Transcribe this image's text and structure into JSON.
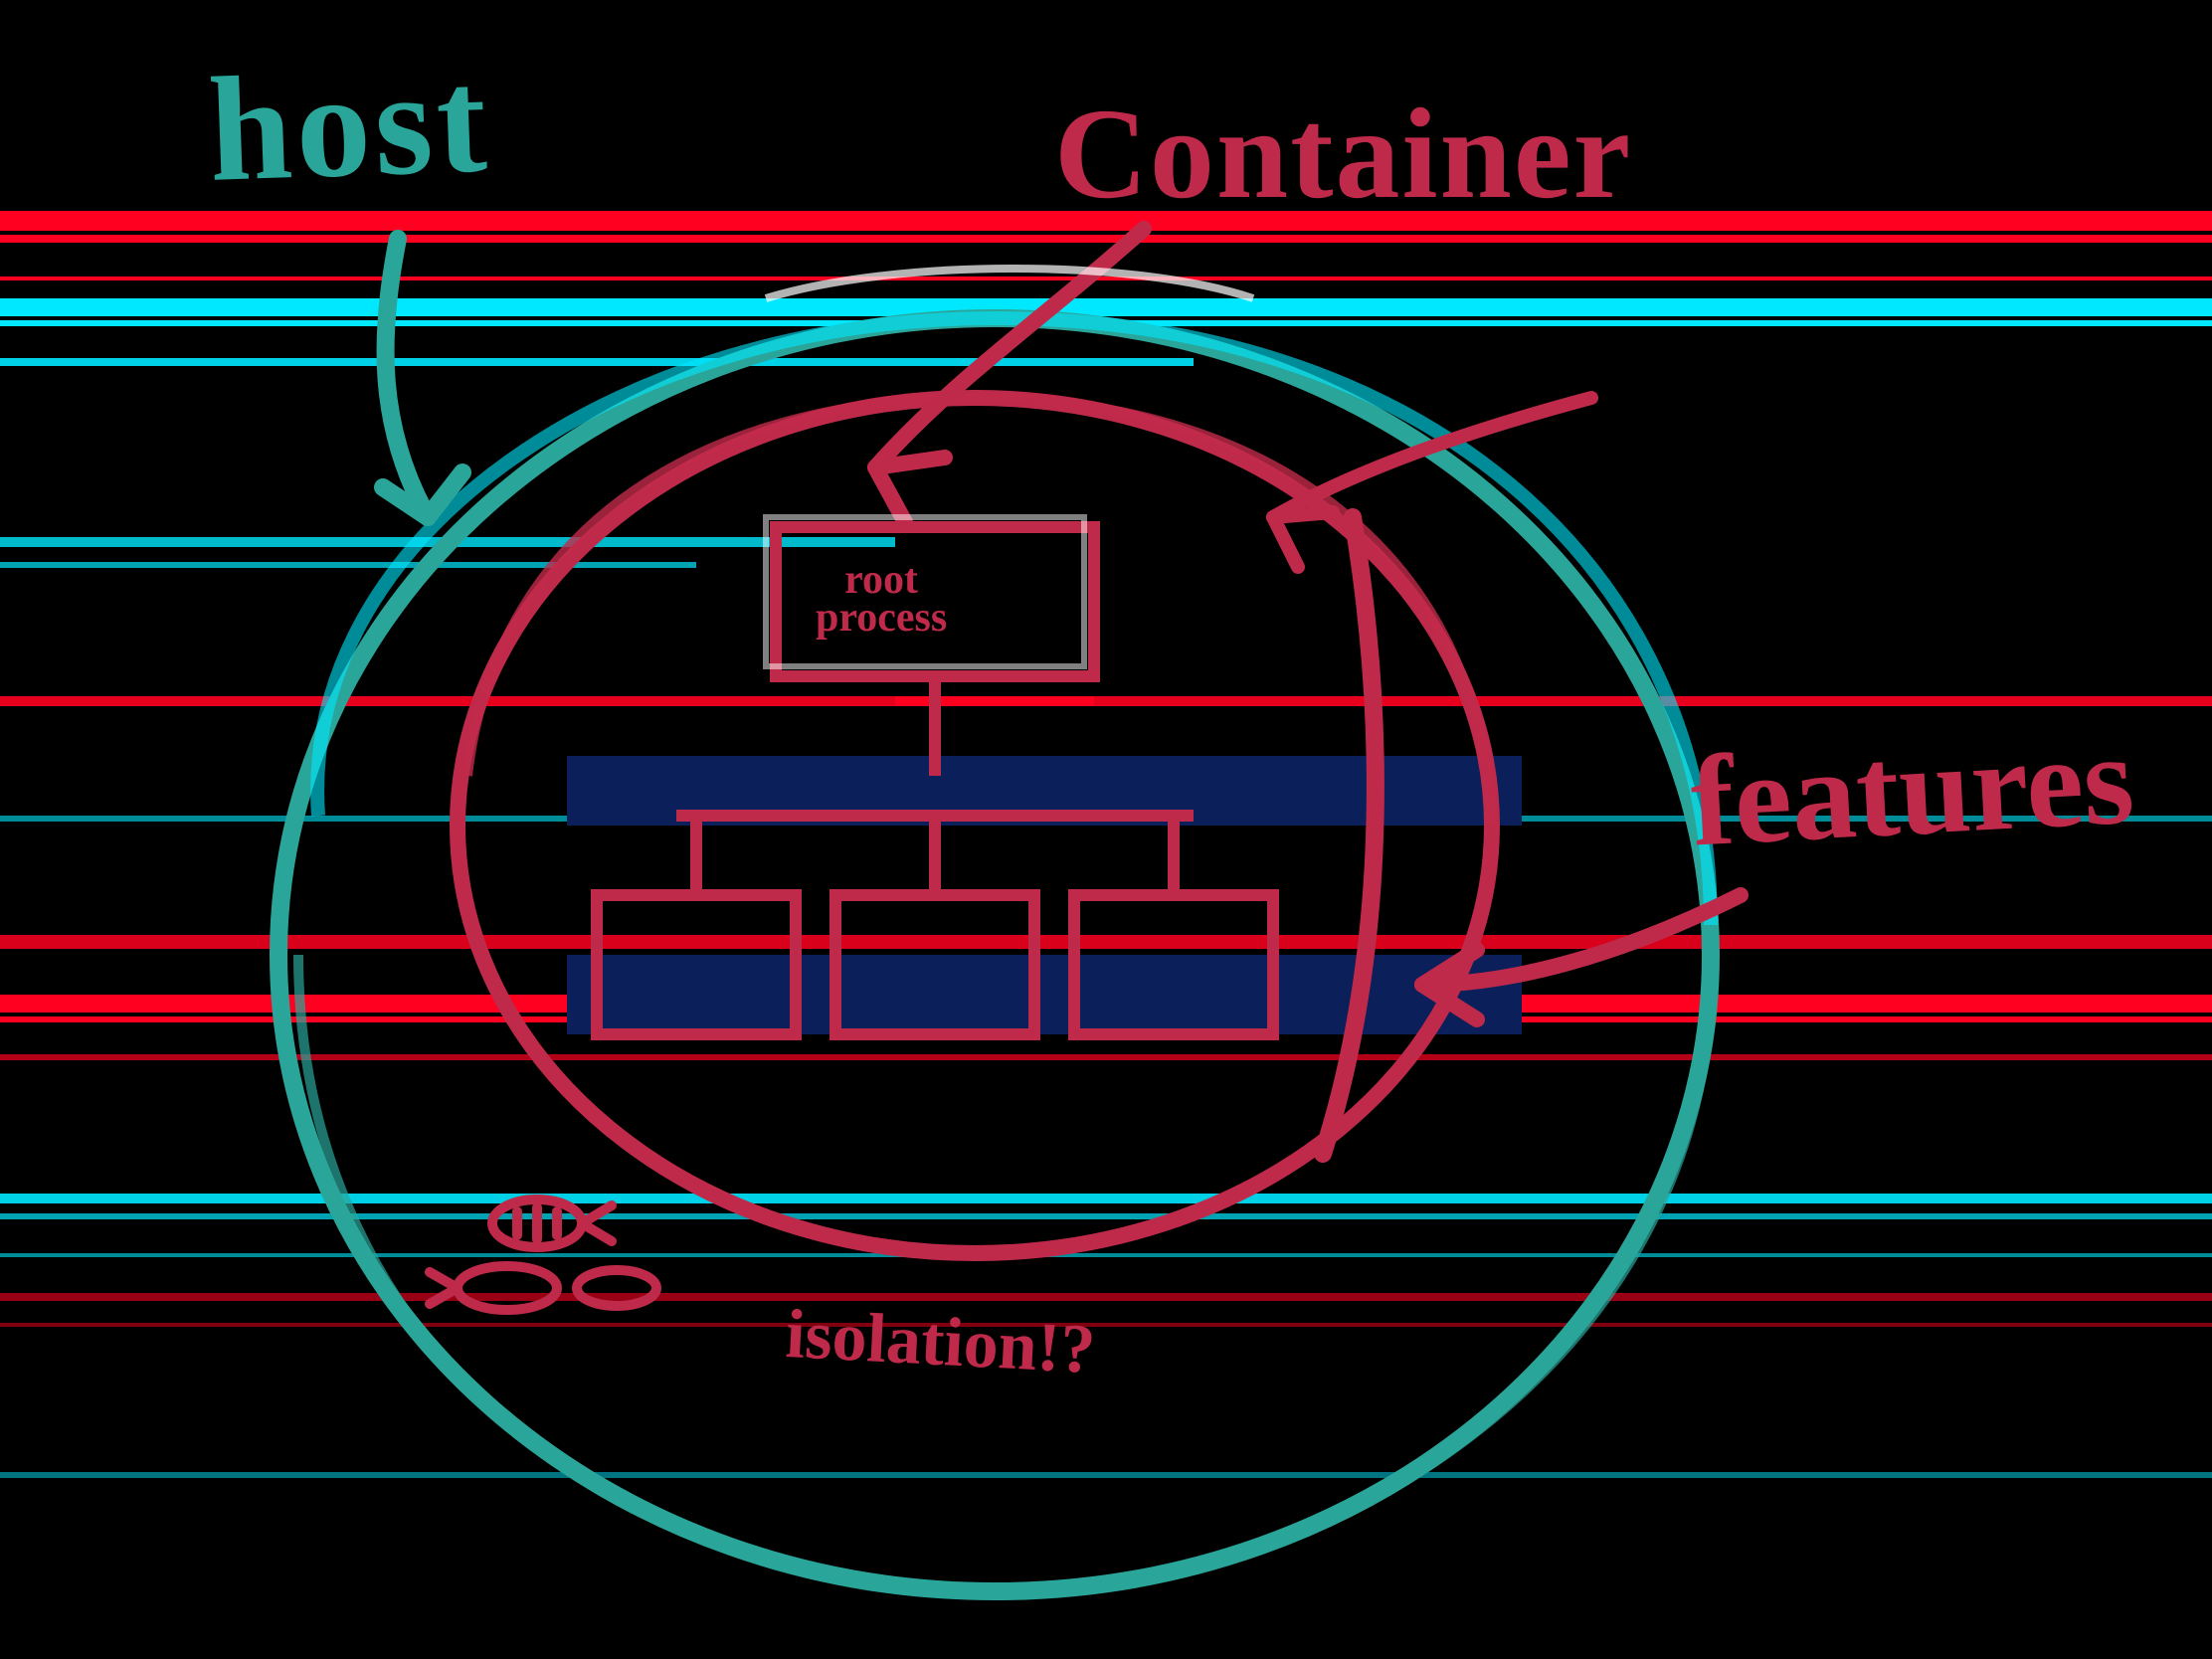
{
  "labels": {
    "host": "host",
    "container": "Container",
    "features": "features",
    "isolation": "isolation!?",
    "root_process_line1": "root",
    "root_process_line2": "process"
  },
  "colors": {
    "teal_dim": "#2aa59a",
    "cyan_bright": "#00e8ff",
    "red": "#c02a4a",
    "red_bright": "#ff0030",
    "navy": "#0b1f5a"
  }
}
